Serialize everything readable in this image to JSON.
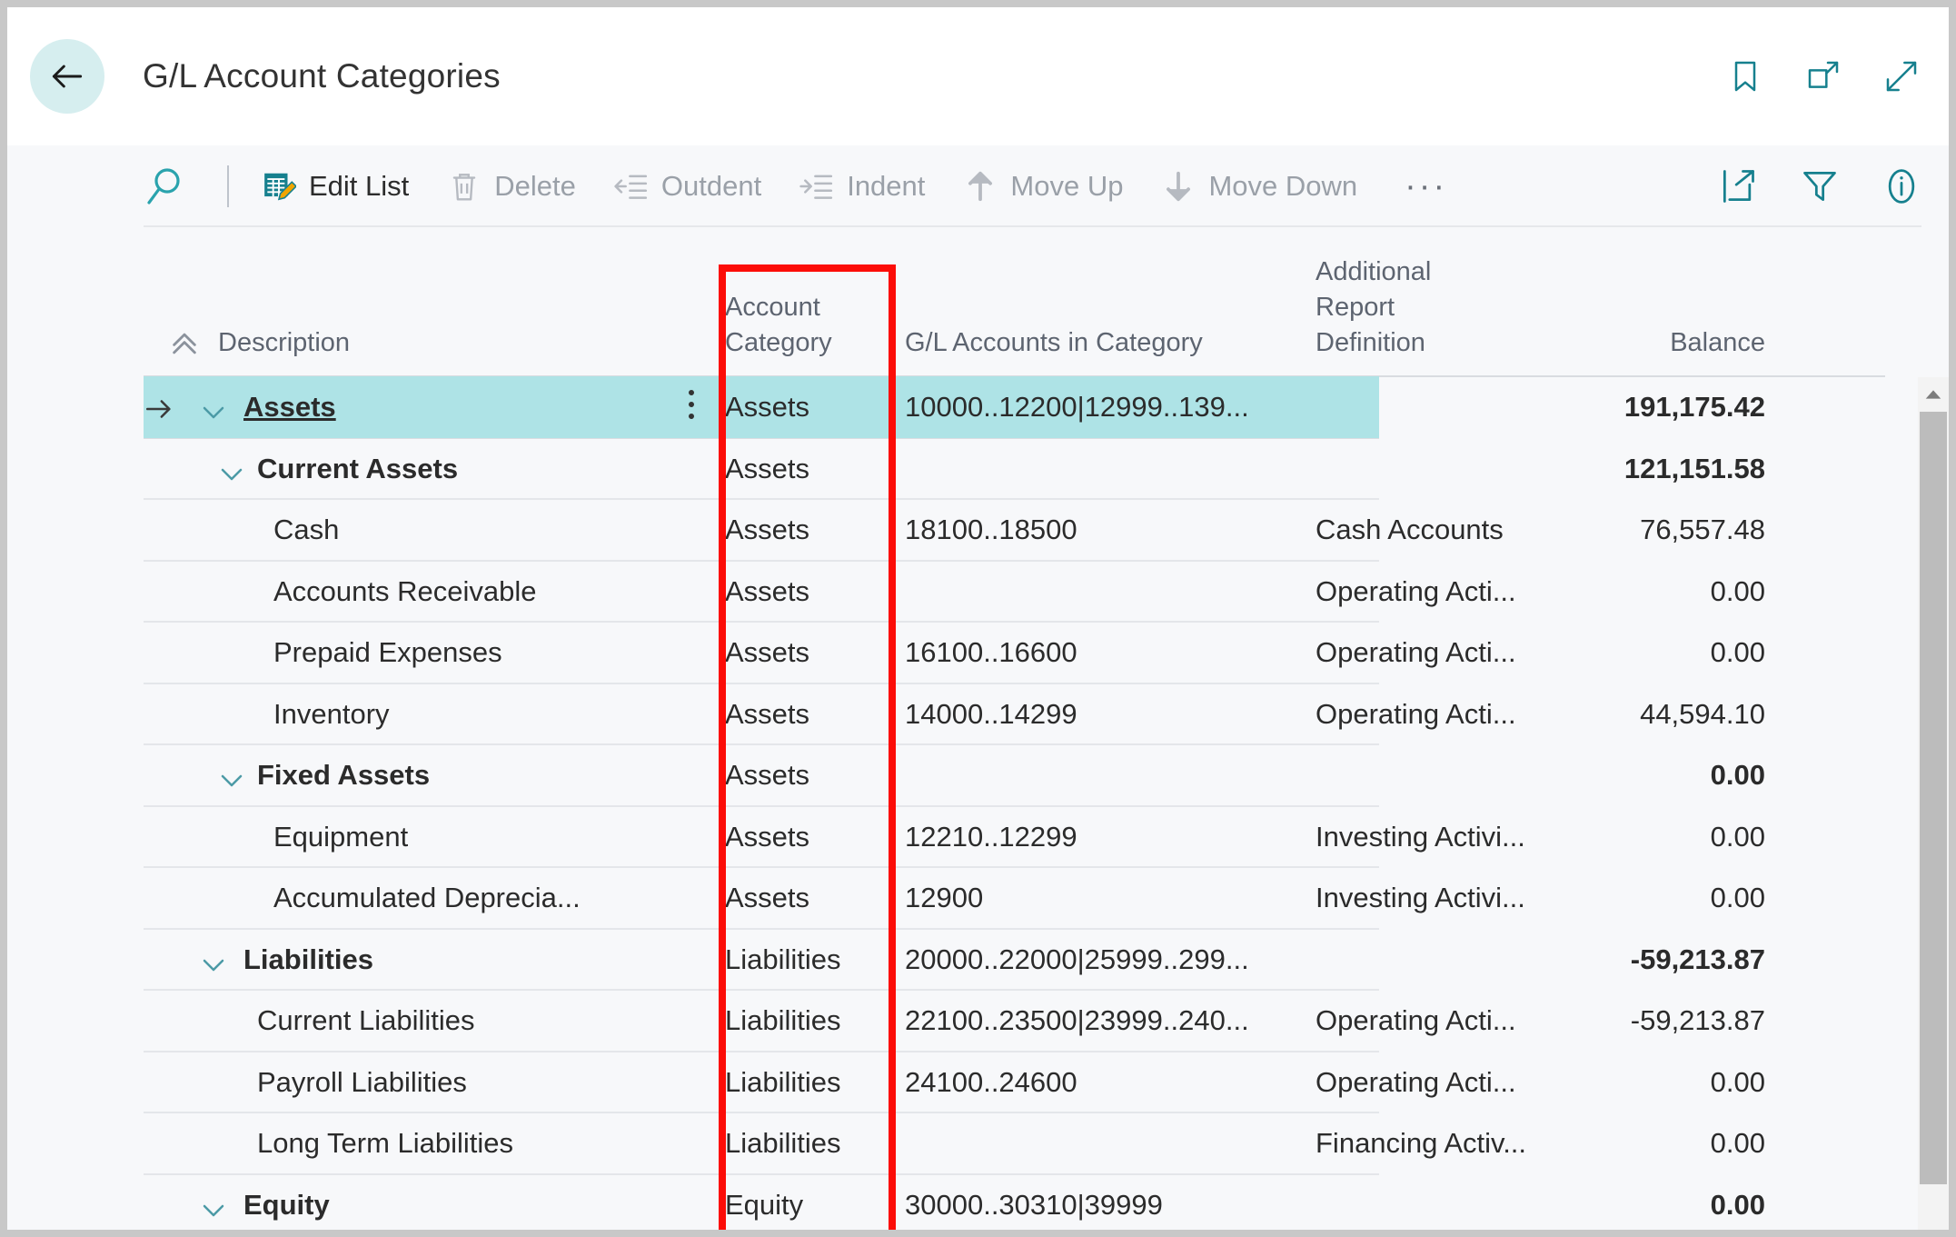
{
  "window": {
    "title": "G/L Account Categories"
  },
  "title_actions": [
    {
      "name": "bookmark-icon",
      "label": "Bookmark"
    },
    {
      "name": "open-in-new-window-icon",
      "label": "Open in new window"
    },
    {
      "name": "expand-icon",
      "label": "Expand"
    }
  ],
  "toolbar": {
    "search_label": "Search",
    "items": [
      {
        "label": "Edit List",
        "icon": "edit-list-icon",
        "enabled": true
      },
      {
        "label": "Delete",
        "icon": "delete-icon",
        "enabled": false
      },
      {
        "label": "Outdent",
        "icon": "outdent-icon",
        "enabled": false
      },
      {
        "label": "Indent",
        "icon": "indent-icon",
        "enabled": false
      },
      {
        "label": "Move Up",
        "icon": "move-up-icon",
        "enabled": false
      },
      {
        "label": "Move Down",
        "icon": "move-down-icon",
        "enabled": false
      }
    ],
    "more_label": "···",
    "right_icons": [
      {
        "name": "share-icon",
        "label": "Share"
      },
      {
        "name": "filter-icon",
        "label": "Filter"
      },
      {
        "name": "info-icon",
        "label": "Information"
      }
    ]
  },
  "table": {
    "columns": [
      {
        "key": "description",
        "label": "Description",
        "sorted": true,
        "sort_dir": "asc"
      },
      {
        "key": "account_category",
        "label": "Account\nCategory"
      },
      {
        "key": "gl_accounts",
        "label": "G/L Accounts in Category"
      },
      {
        "key": "additional_report_definition",
        "label": "Additional\nReport\nDefinition"
      },
      {
        "key": "balance",
        "label": "Balance"
      }
    ],
    "rows": [
      {
        "description": "Assets",
        "indent": 0,
        "bold": true,
        "link": true,
        "expanded": true,
        "selected": true,
        "has_kebab": true,
        "account_category": "Assets",
        "gl_accounts": "10000..12200|12999..139...",
        "additional_report_definition": "",
        "balance": "191,175.42",
        "balance_bold": true
      },
      {
        "description": "Current Assets",
        "indent": 1,
        "bold": true,
        "expanded": true,
        "account_category": "Assets",
        "gl_accounts": "",
        "additional_report_definition": "",
        "balance": "121,151.58",
        "balance_bold": true
      },
      {
        "description": "Cash",
        "indent": 2,
        "bold": false,
        "account_category": "Assets",
        "gl_accounts": "18100..18500",
        "additional_report_definition": "Cash Accounts",
        "balance": "76,557.48",
        "balance_bold": false
      },
      {
        "description": "Accounts Receivable",
        "indent": 2,
        "bold": false,
        "account_category": "Assets",
        "gl_accounts": "",
        "additional_report_definition": "Operating Acti...",
        "balance": "0.00",
        "balance_bold": false
      },
      {
        "description": "Prepaid Expenses",
        "indent": 2,
        "bold": false,
        "account_category": "Assets",
        "gl_accounts": "16100..16600",
        "additional_report_definition": "Operating Acti...",
        "balance": "0.00",
        "balance_bold": false
      },
      {
        "description": "Inventory",
        "indent": 2,
        "bold": false,
        "account_category": "Assets",
        "gl_accounts": "14000..14299",
        "additional_report_definition": "Operating Acti...",
        "balance": "44,594.10",
        "balance_bold": false
      },
      {
        "description": "Fixed Assets",
        "indent": 1,
        "bold": true,
        "expanded": true,
        "account_category": "Assets",
        "gl_accounts": "",
        "additional_report_definition": "",
        "balance": "0.00",
        "balance_bold": true
      },
      {
        "description": "Equipment",
        "indent": 2,
        "bold": false,
        "account_category": "Assets",
        "gl_accounts": "12210..12299",
        "additional_report_definition": "Investing Activi...",
        "balance": "0.00",
        "balance_bold": false
      },
      {
        "description": "Accumulated Deprecia...",
        "indent": 2,
        "bold": false,
        "account_category": "Assets",
        "gl_accounts": "12900",
        "additional_report_definition": "Investing Activi...",
        "balance": "0.00",
        "balance_bold": false
      },
      {
        "description": "Liabilities",
        "indent": 0,
        "bold": true,
        "expanded": true,
        "account_category": "Liabilities",
        "gl_accounts": "20000..22000|25999..299...",
        "additional_report_definition": "",
        "balance": "-59,213.87",
        "balance_bold": true
      },
      {
        "description": "Current Liabilities",
        "indent": 1,
        "bold": false,
        "account_category": "Liabilities",
        "gl_accounts": "22100..23500|23999..240...",
        "additional_report_definition": "Operating Acti...",
        "balance": "-59,213.87",
        "balance_bold": false
      },
      {
        "description": "Payroll Liabilities",
        "indent": 1,
        "bold": false,
        "account_category": "Liabilities",
        "gl_accounts": "24100..24600",
        "additional_report_definition": "Operating Acti...",
        "balance": "0.00",
        "balance_bold": false
      },
      {
        "description": "Long Term Liabilities",
        "indent": 1,
        "bold": false,
        "account_category": "Liabilities",
        "gl_accounts": "",
        "additional_report_definition": "Financing Activ...",
        "balance": "0.00",
        "balance_bold": false
      },
      {
        "description": "Equity",
        "indent": 0,
        "bold": true,
        "expanded": true,
        "account_category": "Equity",
        "gl_accounts": "30000..30310|39999",
        "additional_report_definition": "",
        "balance": "0.00",
        "balance_bold": true
      }
    ]
  },
  "annotation": {
    "name": "account-category-highlight",
    "color": "#fc0d08"
  },
  "colors": {
    "accent": "#16808e",
    "selected_row": "#aee3e6",
    "back_button_bg": "#d6eeef",
    "command_bar_bg": "#f7f8fa",
    "annotation_red": "#fc0d08"
  }
}
